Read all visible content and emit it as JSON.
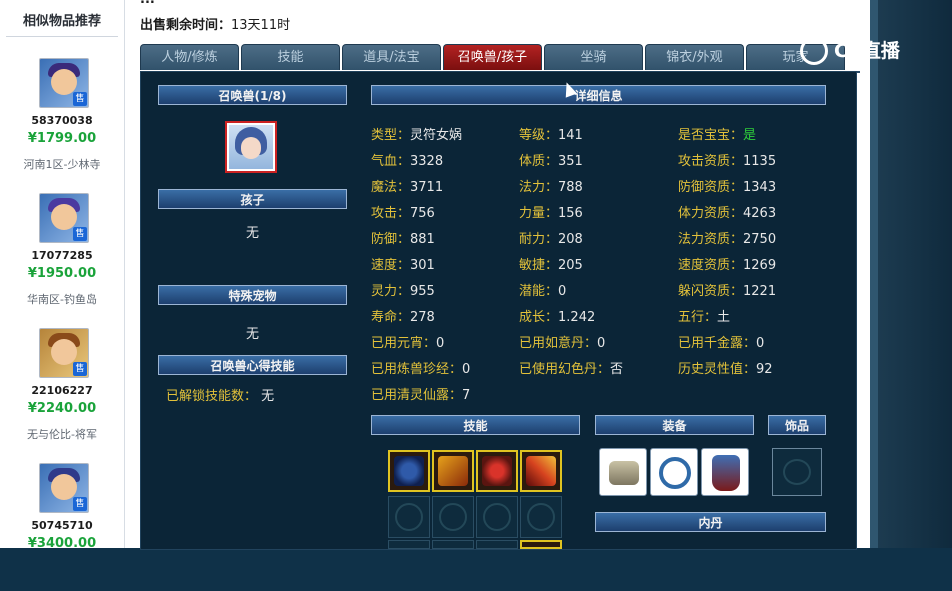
{
  "left_panel": {
    "title": "相似物品推荐",
    "items": [
      {
        "id": "58370038",
        "price": "¥1799.00",
        "server": "河南1区-少林寺",
        "badge": "售"
      },
      {
        "id": "17077285",
        "price": "¥1950.00",
        "server": "华南区-钓鱼岛",
        "badge": "售"
      },
      {
        "id": "22106227",
        "price": "¥2240.00",
        "server": "无与伦比-将军",
        "badge": "售"
      },
      {
        "id": "50745710",
        "price": "¥3400.00",
        "server": "",
        "badge": "售"
      }
    ]
  },
  "header": {
    "partial_top_text": "...",
    "sale_time_label": "出售剩余时间：",
    "sale_time_value": "13天11时"
  },
  "tabs": [
    {
      "label": "人物/修炼",
      "active": false
    },
    {
      "label": "技能",
      "active": false
    },
    {
      "label": "道具/法宝",
      "active": false
    },
    {
      "label": "召唤兽/孩子",
      "active": true
    },
    {
      "label": "坐骑",
      "active": false
    },
    {
      "label": "锦衣/外观",
      "active": false
    },
    {
      "label": "玩家",
      "active": false
    }
  ],
  "left_col": {
    "pet_header": "召唤兽(1/8)",
    "child_header": "孩子",
    "child_value": "无",
    "pet_item_header": "特殊宠物",
    "pet_item_value": "无",
    "skill_header": "召唤兽心得技能",
    "unlocked_label": "已解锁技能数：",
    "unlocked_value": "无"
  },
  "detail": {
    "header": "详细信息",
    "rows": [
      [
        {
          "label": "类型：",
          "value": "灵符女娲"
        },
        {
          "label": "等级：",
          "value": "141"
        },
        {
          "label": "是否宝宝：",
          "value": "是"
        }
      ],
      [
        {
          "label": "气血：",
          "value": "3328"
        },
        {
          "label": "体质：",
          "value": "351"
        },
        {
          "label": "攻击资质：",
          "value": "1135"
        }
      ],
      [
        {
          "label": "魔法：",
          "value": "3711"
        },
        {
          "label": "法力：",
          "value": "788"
        },
        {
          "label": "防御资质：",
          "value": "1343"
        }
      ],
      [
        {
          "label": "攻击：",
          "value": "756"
        },
        {
          "label": "力量：",
          "value": "156"
        },
        {
          "label": "体力资质：",
          "value": "4263"
        }
      ],
      [
        {
          "label": "防御：",
          "value": "881"
        },
        {
          "label": "耐力：",
          "value": "208"
        },
        {
          "label": "法力资质：",
          "value": "2750"
        }
      ],
      [
        {
          "label": "速度：",
          "value": "301"
        },
        {
          "label": "敏捷：",
          "value": "205"
        },
        {
          "label": "速度资质：",
          "value": "1269"
        }
      ],
      [
        {
          "label": "灵力：",
          "value": "955"
        },
        {
          "label": "潜能：",
          "value": "0"
        },
        {
          "label": "躲闪资质：",
          "value": "1221"
        }
      ],
      [
        {
          "label": "寿命：",
          "value": "278"
        },
        {
          "label": "成长：",
          "value": "1.242"
        },
        {
          "label": "五行：",
          "value": "土"
        }
      ],
      [
        {
          "label": "已用元宵：",
          "value": "0"
        },
        {
          "label": "已用如意丹：",
          "value": "0"
        },
        {
          "label": "已用千金露：",
          "value": "0"
        }
      ],
      [
        {
          "label": "已用炼兽珍经：",
          "value": "0"
        },
        {
          "label": "已使用幻色丹：",
          "value": "否"
        },
        {
          "label": "历史灵性值：",
          "value": "92"
        }
      ],
      [
        {
          "label": "已用清灵仙露：",
          "value": "7"
        }
      ]
    ]
  },
  "bottom": {
    "skills_header": "技能",
    "equip_header": "装备",
    "accessory_header": "饰品",
    "neidan_header": "内丹"
  },
  "watermark": {
    "text": "CC直播"
  },
  "colors": {
    "label": "#e2c13a",
    "value": "#e8e8e8",
    "green": "#2fcf3a",
    "tab_active": "#b32222"
  }
}
